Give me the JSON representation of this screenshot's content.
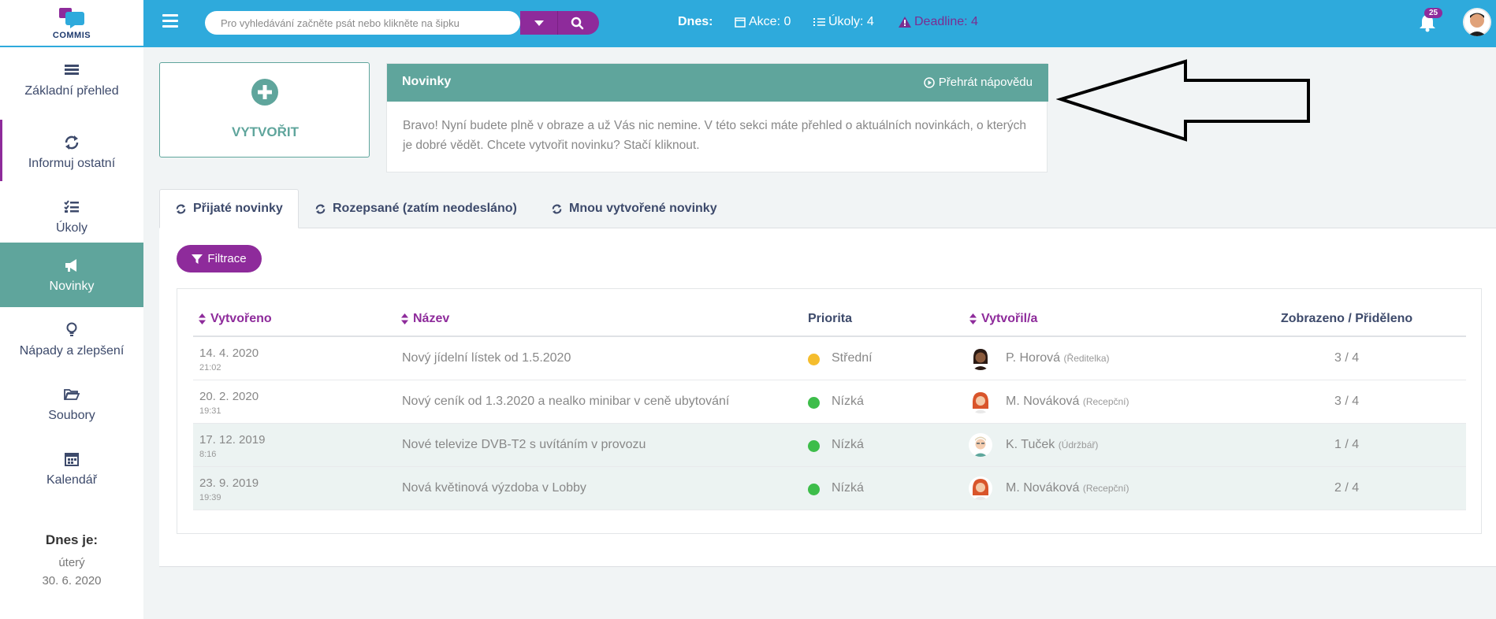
{
  "app": {
    "logo_text": "COMMIS"
  },
  "topbar": {
    "search_placeholder": "Pro vyhledávání začněte psát nebo klikněte na šipku",
    "today_label": "Dnes:",
    "akce": "Akce: 0",
    "ukoly": "Úkoly: 4",
    "deadline": "Deadline: 4",
    "notification_count": "25"
  },
  "sidebar": {
    "items": [
      {
        "label": "Základní přehled",
        "icon": "list-icon"
      },
      {
        "label": "Informuj ostatní",
        "icon": "sync-icon"
      },
      {
        "label": "Úkoly",
        "icon": "checklist-icon"
      },
      {
        "label": "Novinky",
        "icon": "megaphone-icon"
      },
      {
        "label": "Nápady a zlepšení",
        "icon": "lightbulb-icon"
      },
      {
        "label": "Soubory",
        "icon": "folder-icon"
      },
      {
        "label": "Kalendář",
        "icon": "calendar-icon"
      }
    ],
    "today_title": "Dnes je:",
    "today_day": "úterý",
    "today_date": "30. 6. 2020"
  },
  "create": {
    "label": "VYTVOŘIT"
  },
  "news_card": {
    "title": "Novinky",
    "help": "Přehrát nápovědu",
    "body": "Bravo! Nyní budete plně v obraze a už Vás nic nemine. V této sekci máte přehled o aktuálních novinkách, o kterých je dobré vědět. Chcete vytvořit novinku? Stačí kliknout."
  },
  "tabs": [
    {
      "label": "Přijaté novinky",
      "active": true
    },
    {
      "label": "Rozepsané (zatím neodesláno)",
      "active": false
    },
    {
      "label": "Mnou vytvořené novinky",
      "active": false
    }
  ],
  "filter_label": "Filtrace",
  "table": {
    "headers": {
      "created": "Vytvořeno",
      "name": "Název",
      "priority": "Priorita",
      "author": "Vytvořil/a",
      "views": "Zobrazeno / Přiděleno"
    },
    "rows": [
      {
        "date": "14. 4. 2020",
        "time": "21:02",
        "title": "Nový jídelní lístek od 1.5.2020",
        "priority": "Střední",
        "priority_color": "#f5bd2d",
        "author": "P. Horová",
        "role": "(Ředitelka)",
        "views": "3 / 4"
      },
      {
        "date": "20. 2. 2020",
        "time": "19:31",
        "title": "Nový ceník od 1.3.2020 a nealko minibar v ceně ubytování",
        "priority": "Nízká",
        "priority_color": "#3dbd4a",
        "author": "M. Nováková",
        "role": "(Recepční)",
        "views": "3 / 4"
      },
      {
        "date": "17. 12. 2019",
        "time": "8:16",
        "title": "Nové televize DVB-T2 s uvítáním v provozu",
        "priority": "Nízká",
        "priority_color": "#3dbd4a",
        "author": "K. Tuček",
        "role": "(Údržbář)",
        "views": "1 / 4"
      },
      {
        "date": "23. 9. 2019",
        "time": "19:39",
        "title": "Nová květinová výzdoba v Lobby",
        "priority": "Nízká",
        "priority_color": "#3dbd4a",
        "author": "M. Nováková",
        "role": "(Recepční)",
        "views": "2 / 4"
      }
    ]
  },
  "colors": {
    "topbar": "#2eaadc",
    "accent_purple": "#8e2b9b",
    "teal": "#5fa59c"
  }
}
